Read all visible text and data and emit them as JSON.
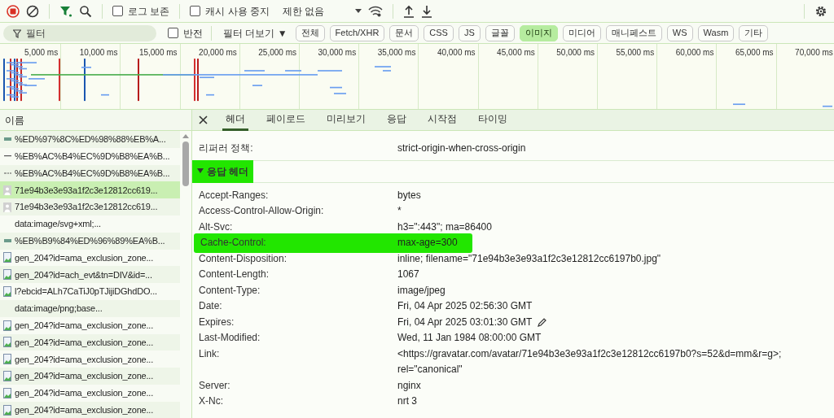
{
  "toolbar": {
    "preserve_log": {
      "label": "로그 보존",
      "checked": false
    },
    "disable_cache": {
      "label": "캐시 사용 중지",
      "checked": false
    },
    "throttling": "제한 없음",
    "filter_active": true
  },
  "filter_bar": {
    "placeholder": "필터",
    "invert": {
      "label": "반전",
      "checked": false
    },
    "more_filters": "필터 더보기 ▼",
    "chips": [
      {
        "label": "전체",
        "selected": false
      },
      {
        "label": "Fetch/XHR",
        "selected": false
      },
      {
        "label": "문서",
        "selected": false
      },
      {
        "label": "CSS",
        "selected": false
      },
      {
        "label": "JS",
        "selected": false
      },
      {
        "label": "글꼴",
        "selected": false
      },
      {
        "label": "이미지",
        "selected": true
      },
      {
        "label": "미디어",
        "selected": false
      },
      {
        "label": "매니페스트",
        "selected": false
      },
      {
        "label": "WS",
        "selected": false
      },
      {
        "label": "Wasm",
        "selected": false
      },
      {
        "label": "기타",
        "selected": false
      }
    ]
  },
  "overview": {
    "ticks": [
      "5,000 ms",
      "10,000 ms",
      "15,000 ms",
      "20,000 ms",
      "25,000 ms",
      "30,000 ms",
      "35,000 ms",
      "40,000 ms",
      "45,000 ms",
      "50,000 ms",
      "55,000 ms",
      "60,000 ms",
      "65,000 ms",
      "70,000 ms"
    ]
  },
  "requests": {
    "column": "이름",
    "rows": [
      {
        "name": "%ED%97%8C%ED%98%88%EB%A...",
        "kind": "strip",
        "selected": false
      },
      {
        "name": "%EB%AC%B4%EC%9D%B8%EA%B...",
        "kind": "line",
        "selected": false
      },
      {
        "name": "%EB%AC%B4%EC%9D%B8%EA%B...",
        "kind": "dashes",
        "selected": false
      },
      {
        "name": "71e94b3e3e93a1f2c3e12812cc619...",
        "kind": "avatar",
        "selected": true
      },
      {
        "name": "71e94b3e3e93a1f2c3e12812cc619...",
        "kind": "avatar",
        "selected": false
      },
      {
        "name": "data:image/svg+xml;...",
        "kind": "none",
        "selected": false
      },
      {
        "name": "%EB%B9%84%ED%96%89%EA%B...",
        "kind": "strip",
        "selected": false
      },
      {
        "name": "gen_204?id=ama_exclusion_zone...",
        "kind": "image",
        "selected": false
      },
      {
        "name": "gen_204?id=ach_evt&tn=DIV&id=...",
        "kind": "image",
        "selected": false
      },
      {
        "name": "l?ebcid=ALh7CaTiJ0pTJijiDGhdDO...",
        "kind": "image",
        "selected": false
      },
      {
        "name": "data:image/png;base...",
        "kind": "none",
        "selected": false
      },
      {
        "name": "gen_204?id=ama_exclusion_zone...",
        "kind": "image",
        "selected": false
      },
      {
        "name": "gen_204?id=ama_exclusion_zone...",
        "kind": "image",
        "selected": false
      },
      {
        "name": "gen_204?id=ama_exclusion_zone...",
        "kind": "image",
        "selected": false
      },
      {
        "name": "gen_204?id=ama_exclusion_zone...",
        "kind": "image",
        "selected": false
      },
      {
        "name": "gen_204?id=ama_exclusion_zone...",
        "kind": "image",
        "selected": false
      },
      {
        "name": "gen_204?id=ama_exclusion_zone...",
        "kind": "image",
        "selected": false
      }
    ]
  },
  "details": {
    "tabs": [
      {
        "label": "헤더",
        "selected": true
      },
      {
        "label": "페이로드",
        "selected": false
      },
      {
        "label": "미리보기",
        "selected": false
      },
      {
        "label": "응답",
        "selected": false
      },
      {
        "label": "시작점",
        "selected": false
      },
      {
        "label": "타이밍",
        "selected": false
      }
    ],
    "general_rows": [
      {
        "label": "리퍼러 정책:",
        "value": "strict-origin-when-cross-origin"
      }
    ],
    "response_headers": {
      "title": "응답 헤더",
      "expanded": true,
      "highlighted": true,
      "rows": [
        {
          "label": "Accept-Ranges:",
          "value": "bytes",
          "highlighted": false
        },
        {
          "label": "Access-Control-Allow-Origin:",
          "value": "*",
          "highlighted": false
        },
        {
          "label": "Alt-Svc:",
          "value": "h3=\":443\"; ma=86400",
          "highlighted": false
        },
        {
          "label": "Cache-Control:",
          "value": "max-age=300",
          "highlighted": true
        },
        {
          "label": "Content-Disposition:",
          "value": "inline; filename=\"71e94b3e3e93a1f2c3e12812cc6197b0.jpg\"",
          "highlighted": false
        },
        {
          "label": "Content-Length:",
          "value": "1067",
          "highlighted": false
        },
        {
          "label": "Content-Type:",
          "value": "image/jpeg",
          "highlighted": false
        },
        {
          "label": "Date:",
          "value": "Fri, 04 Apr 2025 02:56:30 GMT",
          "highlighted": false
        },
        {
          "label": "Expires:",
          "value": "Fri, 04 Apr 2025 03:01:30 GMT",
          "highlighted": false,
          "editable": true
        },
        {
          "label": "Last-Modified:",
          "value": "Wed, 11 Jan 1984 08:00:00 GMT",
          "highlighted": false
        },
        {
          "label": "Link:",
          "value": "<https://gravatar.com/avatar/71e94b3e3e93a1f2c3e12812cc6197b0?s=52&d=mm&r=g>; rel=\"canonical\"",
          "highlighted": false
        },
        {
          "label": "Server:",
          "value": "nginx",
          "highlighted": false
        },
        {
          "label": "X-Nc:",
          "value": "nrt 3",
          "highlighted": false
        }
      ]
    }
  }
}
